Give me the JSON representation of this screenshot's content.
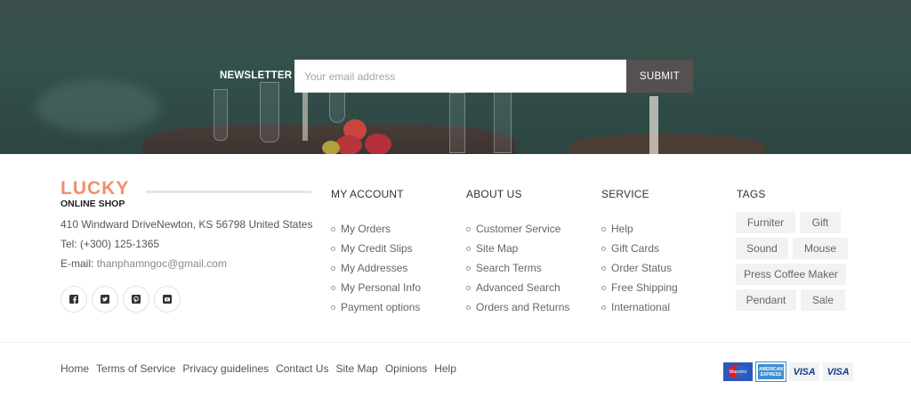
{
  "newsletter": {
    "label": "NEWSLETTER",
    "placeholder": "Your email address",
    "submit_label": "SUBMIT"
  },
  "brand": {
    "name": "LUCKY",
    "tagline": "ONLINE SHOP",
    "address": "410 Windward DriveNewton, KS 56798 United States",
    "tel": "Tel: (+300) 125-1365",
    "email_label": "E-mail:",
    "email": "thanphamngoc@gmail.com",
    "socials": [
      "facebook-icon",
      "twitter-icon",
      "pinterest-icon",
      "youtube-icon"
    ]
  },
  "columns": [
    {
      "title": "MY ACCOUNT",
      "items": [
        "My Orders",
        "My Credit Slips",
        "My Addresses",
        "My Personal Info",
        "Payment options"
      ]
    },
    {
      "title": "ABOUT US",
      "items": [
        "Customer Service",
        "Site Map",
        "Search Terms",
        "Advanced Search",
        "Orders and Returns"
      ]
    },
    {
      "title": "SERVICE",
      "items": [
        "Help",
        "Gift Cards",
        "Order Status",
        "Free Shipping",
        "International"
      ]
    }
  ],
  "tags": {
    "title": "TAGS",
    "items": [
      "Furniter",
      "Gift",
      "Sound",
      "Mouse",
      "Press Coffee Maker",
      "Pendant",
      "Sale"
    ]
  },
  "bottom_links": [
    "Home",
    "Terms of Service",
    "Privacy guidelines",
    "Contact Us",
    "Site Map",
    "Opinions",
    "Help"
  ],
  "payments": {
    "maestro": "Maestro",
    "amex": "AMERICAN EXPRESS",
    "visa1": "VISA",
    "visa2": "VISA"
  },
  "colors": {
    "brand_accent": "#f0906a",
    "banner_bg": "#34504b",
    "submit_bg": "#555150"
  }
}
